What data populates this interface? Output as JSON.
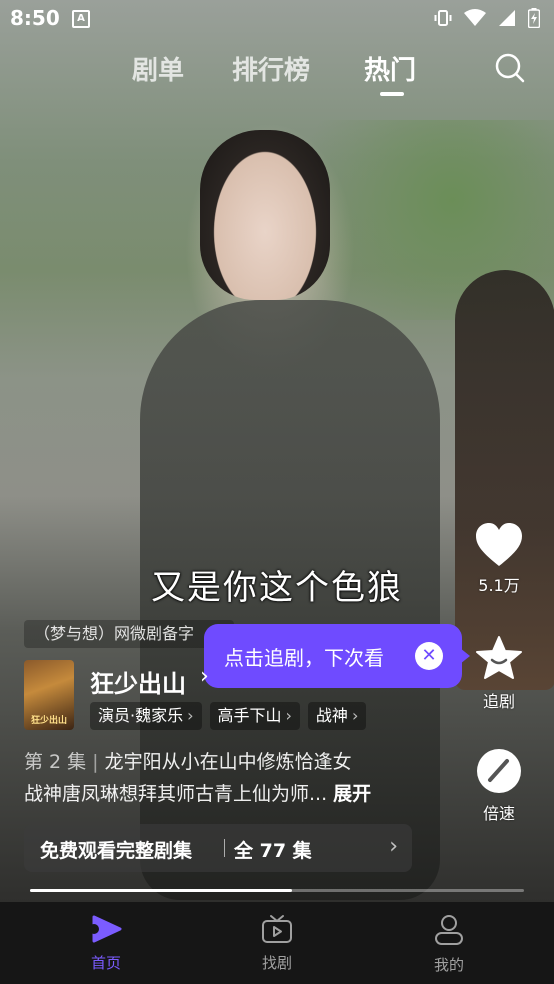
{
  "status_bar": {
    "time": "8:50",
    "notification_badge": "A"
  },
  "top_tabs": [
    {
      "label": "剧单",
      "active": false
    },
    {
      "label": "排行榜",
      "active": false
    },
    {
      "label": "热门",
      "active": true
    }
  ],
  "subtitle": "又是你这个色狼",
  "actions": {
    "like_count": "5.1万",
    "follow_label": "追剧",
    "speed_label": "倍速"
  },
  "registration_notice": "（梦与想）网微剧备字",
  "tooltip": {
    "text": "点击追剧，下次看"
  },
  "drama": {
    "poster_text": "狂少出山",
    "title": "狂少出山",
    "tags": [
      "演员·魏家乐",
      "高手下山",
      "战神"
    ],
    "episode_label": "第 2 集",
    "description_line1": "龙宇阳从小在山中修炼恰逢女",
    "description_line2": "战神唐凤琳想拜其师古青上仙为师...",
    "expand_label": "展开"
  },
  "full_episode_button": {
    "label": "免费观看完整剧集",
    "count_label": "全 77 集"
  },
  "playback": {
    "progress_fraction": 0.53
  },
  "bottom_nav": [
    {
      "label": "首页",
      "icon": "play-icon",
      "active": true
    },
    {
      "label": "找剧",
      "icon": "tv-icon",
      "active": false
    },
    {
      "label": "我的",
      "icon": "user-icon",
      "active": false
    }
  ],
  "colors": {
    "accent": "#7b5cff",
    "tooltip_bg": "#6f4bff",
    "nav_bg": "#161616"
  }
}
